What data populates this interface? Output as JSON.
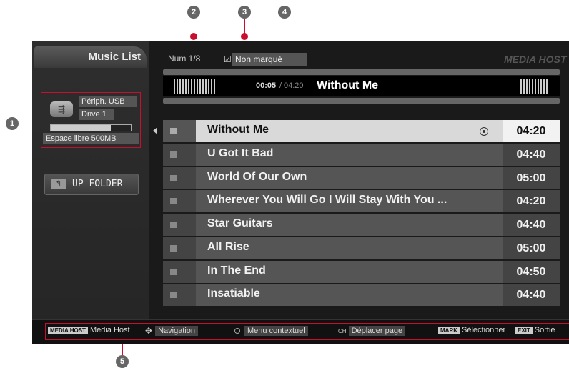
{
  "callouts": [
    "1",
    "2",
    "3",
    "4",
    "5"
  ],
  "sidebar": {
    "title": "Music List",
    "device": {
      "icon": "usb-icon",
      "name": "Périph. USB",
      "drive": "Drive 1",
      "usage_fraction": 0.75,
      "free_space": "Espace libre 500MB"
    },
    "up_folder": {
      "icon": "folder-up-icon",
      "label": "UP FOLDER"
    }
  },
  "header": {
    "page_info": "Num 1/8",
    "mark_check": "☑",
    "mark_label": "Non marqué",
    "logo": "MEDIA HOST"
  },
  "now_playing": {
    "current_time": "00:05",
    "separator": "/",
    "total_time": "04:20",
    "title": "Without Me"
  },
  "tracks": [
    {
      "title": "Without Me",
      "duration": "04:20",
      "selected": true
    },
    {
      "title": "U Got It Bad",
      "duration": "04:40"
    },
    {
      "title": "World Of Our Own",
      "duration": "05:00"
    },
    {
      "title": "Wherever You Will Go I Will Stay With You ...",
      "duration": "04:20"
    },
    {
      "title": "Star Guitars",
      "duration": "04:40"
    },
    {
      "title": "All Rise",
      "duration": "05:00"
    },
    {
      "title": "In The End",
      "duration": "04:50"
    },
    {
      "title": "Insatiable",
      "duration": "04:40"
    }
  ],
  "footer": {
    "media_host_key": "MEDIA HOST",
    "media_host_label": "Media Host",
    "navigation_label": "Navigation",
    "menu_label": "Menu contextuel",
    "ch_key": "CH",
    "page_label": "Déplacer page",
    "mark_key": "MARK",
    "select_label": "Sélectionner",
    "exit_key": "EXIT",
    "exit_label": "Sortie"
  },
  "colors": {
    "callout_line": "#c8102e",
    "callout_marker": "#666666",
    "selected_row": "#d9d9d9"
  }
}
